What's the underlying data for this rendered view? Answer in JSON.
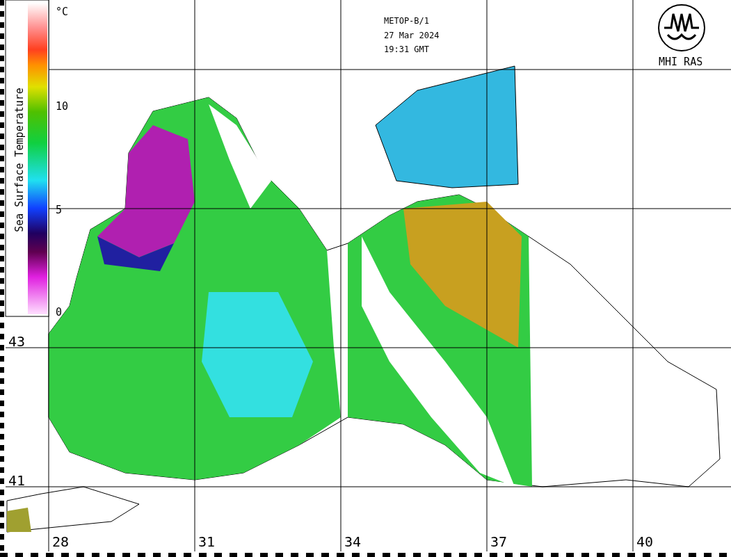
{
  "header": {
    "satellite": "METOP-B/1",
    "date": "27 Mar 2024",
    "time": "19:31 GMT"
  },
  "logo": {
    "label": "MHI RAS"
  },
  "colorbar": {
    "unit": "°C",
    "title": "Sea Surface Temperature",
    "ticks": [
      "10",
      "5",
      "0"
    ]
  },
  "latitude_labels": [
    "43",
    "41"
  ],
  "longitude_labels": [
    "28",
    "31",
    "34",
    "37",
    "40"
  ]
}
